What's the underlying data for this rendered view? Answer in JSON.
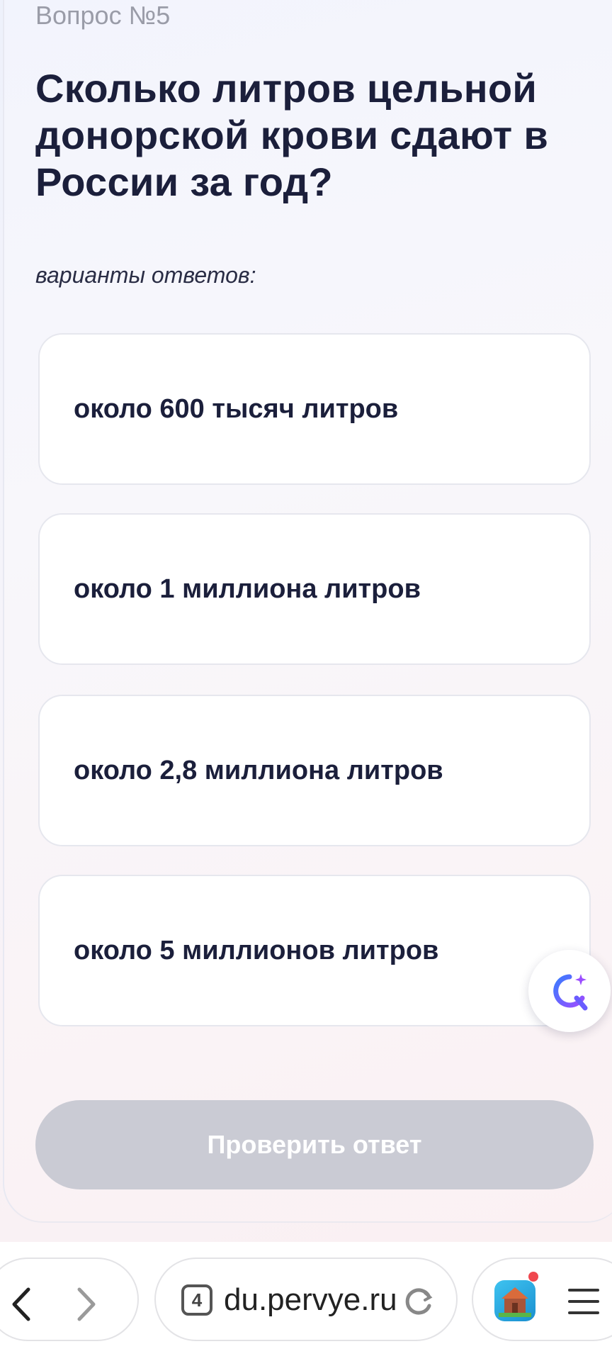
{
  "question": {
    "number": "Вопрос №5",
    "title": "Сколько литров цельной донорской крови сдают в России за год?"
  },
  "answers_caption": "варианты ответов:",
  "answers": [
    {
      "label": "около 600 тысяч литров"
    },
    {
      "label": "около 1 миллиона литров"
    },
    {
      "label": "около 2,8 миллиона литров"
    },
    {
      "label": "около 5 миллионов литров"
    }
  ],
  "check_button": {
    "label": "Проверить ответ",
    "enabled": false
  },
  "assistant": {
    "icon": "ai-assistant-icon"
  },
  "browser": {
    "tab_count": "4",
    "url": "du.pervye.ru",
    "icons": [
      "back-arrow-icon",
      "forward-arrow-icon",
      "reload-icon",
      "app-icon",
      "menu-icon"
    ]
  },
  "colors": {
    "title": "#1b1f3b",
    "button_disabled": "#cacbd4",
    "card_border": "#e6e7ee",
    "notification": "#f0474e"
  }
}
